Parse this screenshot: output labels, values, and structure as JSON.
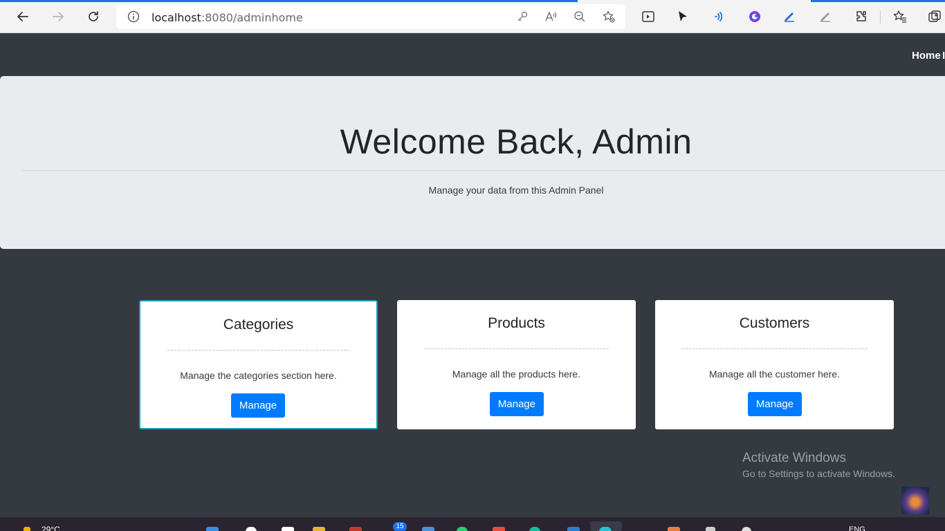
{
  "browser": {
    "url_host": "localhost",
    "url_path": ":8080/adminhome"
  },
  "navbar": {
    "home_link": "Home",
    "next_link_partial": "I"
  },
  "jumbotron": {
    "title": "Welcome Back, Admin",
    "subtitle": "Manage your data from this Admin Panel"
  },
  "cards": [
    {
      "title": "Categories",
      "text": "Manage the categories section here.",
      "button": "Manage"
    },
    {
      "title": "Products",
      "text": "Manage all the products here.",
      "button": "Manage"
    },
    {
      "title": "Customers",
      "text": "Manage all the customer here.",
      "button": "Manage"
    }
  ],
  "watermark": {
    "title": "Activate Windows",
    "subtitle": "Go to Settings to activate Windows."
  },
  "taskbar": {
    "temperature": "29°C",
    "notification_count": "15",
    "language": "ENG"
  },
  "colors": {
    "navbar_bg": "#343a40",
    "jumbotron_bg": "#e9ecef",
    "button_primary": "#007bff",
    "card_focus_border": "#17a2b8"
  }
}
